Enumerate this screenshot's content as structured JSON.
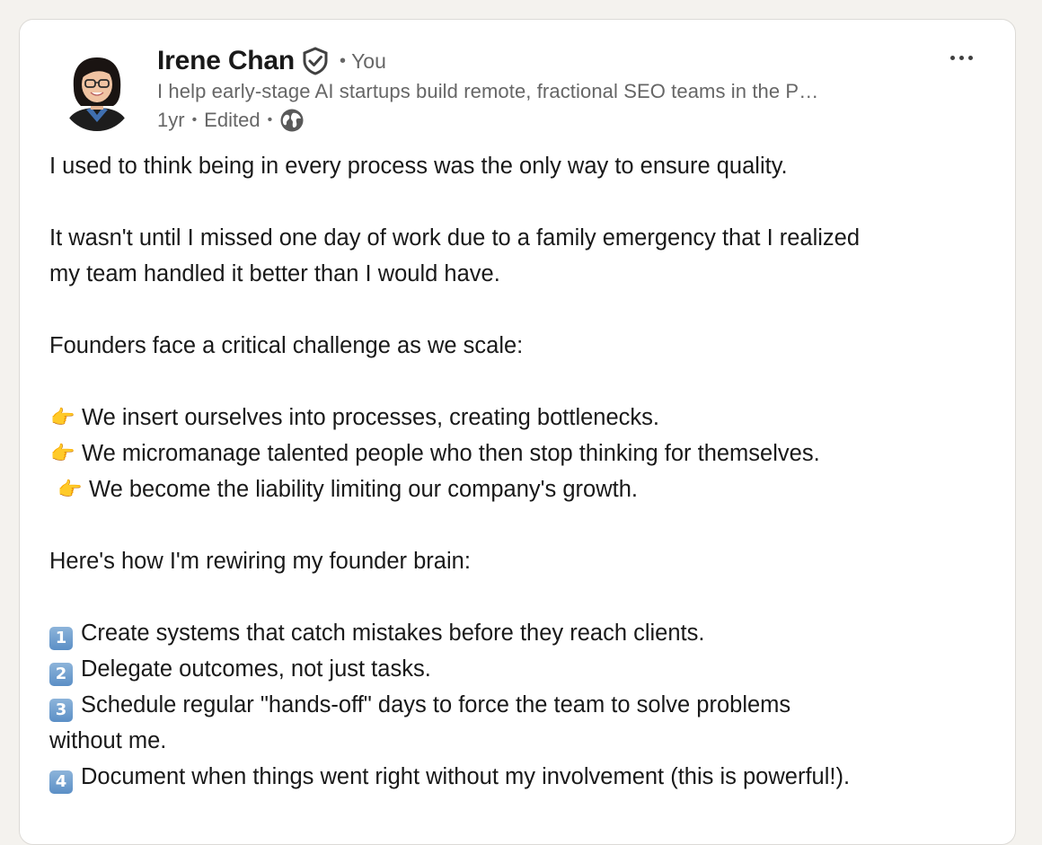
{
  "author": {
    "name": "Irene Chan",
    "relation": "You",
    "headline": "I help early-stage AI startups build remote, fractional SEO teams in the P…",
    "time": "1yr",
    "edited": "Edited",
    "visibility_icon": "globe-icon",
    "verified_icon": "verified-shield-icon"
  },
  "menu": {
    "icon": "more-options-icon"
  },
  "post": {
    "lines": {
      "l1": "I used to think being in every process was the only way to ensure quality.",
      "l2": "It wasn't until I missed one day of work due to a family emergency that I realized",
      "l3": "my team handled it better than I would have.",
      "l4": "Founders face a critical challenge as we scale:",
      "b1": "We insert ourselves into processes, creating bottlenecks.",
      "b2": "We micromanage talented people who then stop thinking for themselves.",
      "b3": "We become the liability limiting our company's growth.",
      "l5": "Here's how I'm rewiring my founder brain:",
      "n1": "Create systems that catch mistakes before they reach clients.",
      "n2": "Delegate outcomes, not just tasks.",
      "n3a": "Schedule regular \"hands-off\" days to force the team to solve problems",
      "n3b": "without me.",
      "n4": "Document when things went right without my involvement (this is powerful!)."
    },
    "keycaps": {
      "k1": "1",
      "k2": "2",
      "k3": "3",
      "k4": "4"
    },
    "bullet_emoji": "👉"
  },
  "colors": {
    "page_bg": "#f4f2ee",
    "card_bg": "#ffffff",
    "text_primary": "#191919",
    "text_secondary": "#666666",
    "keycap_blue": "#5b8fc6"
  }
}
